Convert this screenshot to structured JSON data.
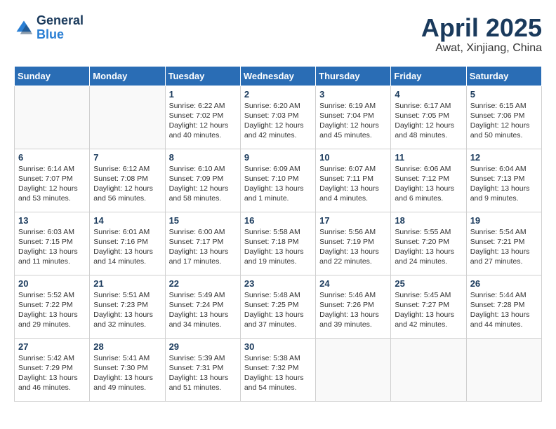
{
  "header": {
    "logo": {
      "general": "General",
      "blue": "Blue"
    },
    "title": "April 2025",
    "location": "Awat, Xinjiang, China"
  },
  "weekdays": [
    "Sunday",
    "Monday",
    "Tuesday",
    "Wednesday",
    "Thursday",
    "Friday",
    "Saturday"
  ],
  "weeks": [
    [
      {
        "day": "",
        "sunrise": "",
        "sunset": "",
        "daylight": ""
      },
      {
        "day": "",
        "sunrise": "",
        "sunset": "",
        "daylight": ""
      },
      {
        "day": "1",
        "sunrise": "Sunrise: 6:22 AM",
        "sunset": "Sunset: 7:02 PM",
        "daylight": "Daylight: 12 hours and 40 minutes."
      },
      {
        "day": "2",
        "sunrise": "Sunrise: 6:20 AM",
        "sunset": "Sunset: 7:03 PM",
        "daylight": "Daylight: 12 hours and 42 minutes."
      },
      {
        "day": "3",
        "sunrise": "Sunrise: 6:19 AM",
        "sunset": "Sunset: 7:04 PM",
        "daylight": "Daylight: 12 hours and 45 minutes."
      },
      {
        "day": "4",
        "sunrise": "Sunrise: 6:17 AM",
        "sunset": "Sunset: 7:05 PM",
        "daylight": "Daylight: 12 hours and 48 minutes."
      },
      {
        "day": "5",
        "sunrise": "Sunrise: 6:15 AM",
        "sunset": "Sunset: 7:06 PM",
        "daylight": "Daylight: 12 hours and 50 minutes."
      }
    ],
    [
      {
        "day": "6",
        "sunrise": "Sunrise: 6:14 AM",
        "sunset": "Sunset: 7:07 PM",
        "daylight": "Daylight: 12 hours and 53 minutes."
      },
      {
        "day": "7",
        "sunrise": "Sunrise: 6:12 AM",
        "sunset": "Sunset: 7:08 PM",
        "daylight": "Daylight: 12 hours and 56 minutes."
      },
      {
        "day": "8",
        "sunrise": "Sunrise: 6:10 AM",
        "sunset": "Sunset: 7:09 PM",
        "daylight": "Daylight: 12 hours and 58 minutes."
      },
      {
        "day": "9",
        "sunrise": "Sunrise: 6:09 AM",
        "sunset": "Sunset: 7:10 PM",
        "daylight": "Daylight: 13 hours and 1 minute."
      },
      {
        "day": "10",
        "sunrise": "Sunrise: 6:07 AM",
        "sunset": "Sunset: 7:11 PM",
        "daylight": "Daylight: 13 hours and 4 minutes."
      },
      {
        "day": "11",
        "sunrise": "Sunrise: 6:06 AM",
        "sunset": "Sunset: 7:12 PM",
        "daylight": "Daylight: 13 hours and 6 minutes."
      },
      {
        "day": "12",
        "sunrise": "Sunrise: 6:04 AM",
        "sunset": "Sunset: 7:13 PM",
        "daylight": "Daylight: 13 hours and 9 minutes."
      }
    ],
    [
      {
        "day": "13",
        "sunrise": "Sunrise: 6:03 AM",
        "sunset": "Sunset: 7:15 PM",
        "daylight": "Daylight: 13 hours and 11 minutes."
      },
      {
        "day": "14",
        "sunrise": "Sunrise: 6:01 AM",
        "sunset": "Sunset: 7:16 PM",
        "daylight": "Daylight: 13 hours and 14 minutes."
      },
      {
        "day": "15",
        "sunrise": "Sunrise: 6:00 AM",
        "sunset": "Sunset: 7:17 PM",
        "daylight": "Daylight: 13 hours and 17 minutes."
      },
      {
        "day": "16",
        "sunrise": "Sunrise: 5:58 AM",
        "sunset": "Sunset: 7:18 PM",
        "daylight": "Daylight: 13 hours and 19 minutes."
      },
      {
        "day": "17",
        "sunrise": "Sunrise: 5:56 AM",
        "sunset": "Sunset: 7:19 PM",
        "daylight": "Daylight: 13 hours and 22 minutes."
      },
      {
        "day": "18",
        "sunrise": "Sunrise: 5:55 AM",
        "sunset": "Sunset: 7:20 PM",
        "daylight": "Daylight: 13 hours and 24 minutes."
      },
      {
        "day": "19",
        "sunrise": "Sunrise: 5:54 AM",
        "sunset": "Sunset: 7:21 PM",
        "daylight": "Daylight: 13 hours and 27 minutes."
      }
    ],
    [
      {
        "day": "20",
        "sunrise": "Sunrise: 5:52 AM",
        "sunset": "Sunset: 7:22 PM",
        "daylight": "Daylight: 13 hours and 29 minutes."
      },
      {
        "day": "21",
        "sunrise": "Sunrise: 5:51 AM",
        "sunset": "Sunset: 7:23 PM",
        "daylight": "Daylight: 13 hours and 32 minutes."
      },
      {
        "day": "22",
        "sunrise": "Sunrise: 5:49 AM",
        "sunset": "Sunset: 7:24 PM",
        "daylight": "Daylight: 13 hours and 34 minutes."
      },
      {
        "day": "23",
        "sunrise": "Sunrise: 5:48 AM",
        "sunset": "Sunset: 7:25 PM",
        "daylight": "Daylight: 13 hours and 37 minutes."
      },
      {
        "day": "24",
        "sunrise": "Sunrise: 5:46 AM",
        "sunset": "Sunset: 7:26 PM",
        "daylight": "Daylight: 13 hours and 39 minutes."
      },
      {
        "day": "25",
        "sunrise": "Sunrise: 5:45 AM",
        "sunset": "Sunset: 7:27 PM",
        "daylight": "Daylight: 13 hours and 42 minutes."
      },
      {
        "day": "26",
        "sunrise": "Sunrise: 5:44 AM",
        "sunset": "Sunset: 7:28 PM",
        "daylight": "Daylight: 13 hours and 44 minutes."
      }
    ],
    [
      {
        "day": "27",
        "sunrise": "Sunrise: 5:42 AM",
        "sunset": "Sunset: 7:29 PM",
        "daylight": "Daylight: 13 hours and 46 minutes."
      },
      {
        "day": "28",
        "sunrise": "Sunrise: 5:41 AM",
        "sunset": "Sunset: 7:30 PM",
        "daylight": "Daylight: 13 hours and 49 minutes."
      },
      {
        "day": "29",
        "sunrise": "Sunrise: 5:39 AM",
        "sunset": "Sunset: 7:31 PM",
        "daylight": "Daylight: 13 hours and 51 minutes."
      },
      {
        "day": "30",
        "sunrise": "Sunrise: 5:38 AM",
        "sunset": "Sunset: 7:32 PM",
        "daylight": "Daylight: 13 hours and 54 minutes."
      },
      {
        "day": "",
        "sunrise": "",
        "sunset": "",
        "daylight": ""
      },
      {
        "day": "",
        "sunrise": "",
        "sunset": "",
        "daylight": ""
      },
      {
        "day": "",
        "sunrise": "",
        "sunset": "",
        "daylight": ""
      }
    ]
  ]
}
